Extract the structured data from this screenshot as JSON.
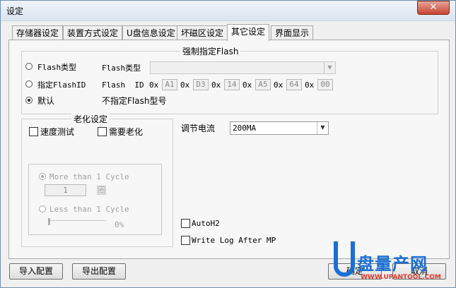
{
  "window": {
    "title": "设定",
    "close_glyph": "✕"
  },
  "tabs": [
    {
      "label": "存储器设定"
    },
    {
      "label": "装置方式设定"
    },
    {
      "label": "U盘信息设定"
    },
    {
      "label": "坏磁区设定"
    },
    {
      "label": "其它设定"
    },
    {
      "label": "界面显示"
    }
  ],
  "active_tab": "其它设定",
  "force_flash": {
    "legend": "强制指定Flash",
    "radio_flash_type": "Flash类型",
    "flash_type_label": "Flash类型",
    "flash_type_value": "",
    "radio_flash_id": "指定FlashID",
    "flash_id_label": "Flash  ID",
    "hex_prefix": "0x",
    "id_bytes": [
      "A1",
      "D3",
      "14",
      "A5",
      "64",
      "00"
    ],
    "radio_default": "默认",
    "default_desc": "不指定Flash型号",
    "selected": "默认"
  },
  "aging": {
    "legend": "老化设定",
    "speed_test": "速度测试",
    "need_aging": "需要老化",
    "speed_test_checked": false,
    "need_aging_checked": false,
    "more_than_cycle": "More than 1 Cycle",
    "cycle_count": "1",
    "cycle_unit": "圈",
    "less_than_cycle": "Less than 1 Cycle",
    "percent_label": "0%",
    "percent_value": 0
  },
  "current": {
    "label": "调节电流",
    "value": "200MA"
  },
  "autoh2": {
    "label": "AutoH2",
    "checked": false
  },
  "write_log": {
    "label": "Write Log After MP",
    "checked": false
  },
  "buttons": {
    "import": "导入配置",
    "export": "导出配置",
    "ok": "确定",
    "cancel": "取消"
  },
  "watermark": {
    "brand": "盘量产网",
    "url": "WWW.UPANTOOL.COM",
    "colors": {
      "blue": "#1a6fd6",
      "red": "#e53a2e"
    }
  }
}
